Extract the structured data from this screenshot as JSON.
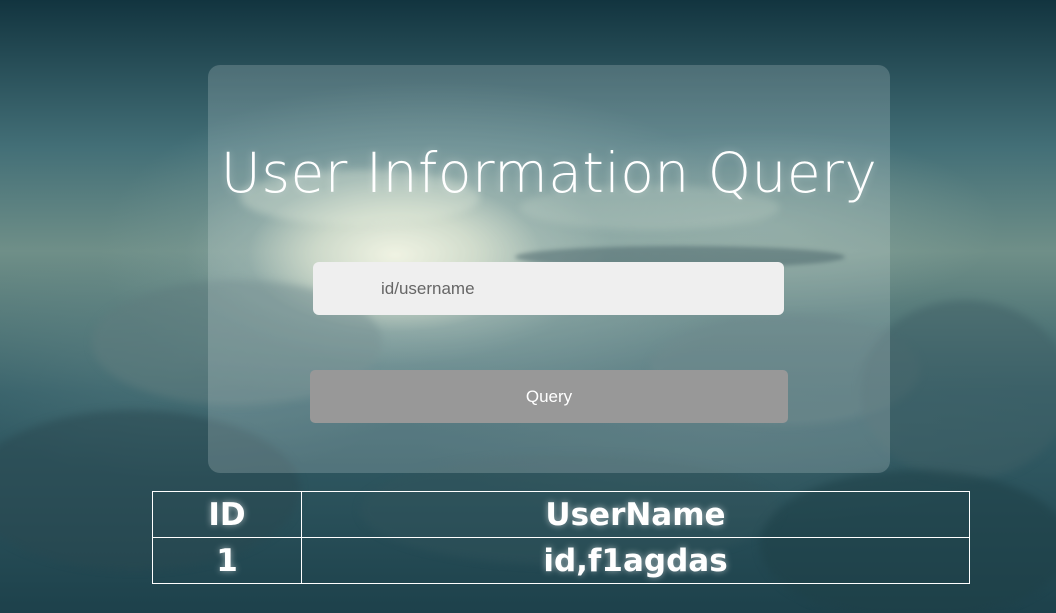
{
  "page": {
    "title": "User Information Query"
  },
  "search": {
    "placeholder": "id/username",
    "value": ""
  },
  "query_button": {
    "label": "Query"
  },
  "results": {
    "columns": [
      "ID",
      "UserName"
    ],
    "rows": [
      [
        "1",
        "id,f1agdas"
      ]
    ]
  },
  "colors": {
    "button": "#989898",
    "input_background": "#efefef",
    "text": "#ffffff"
  }
}
